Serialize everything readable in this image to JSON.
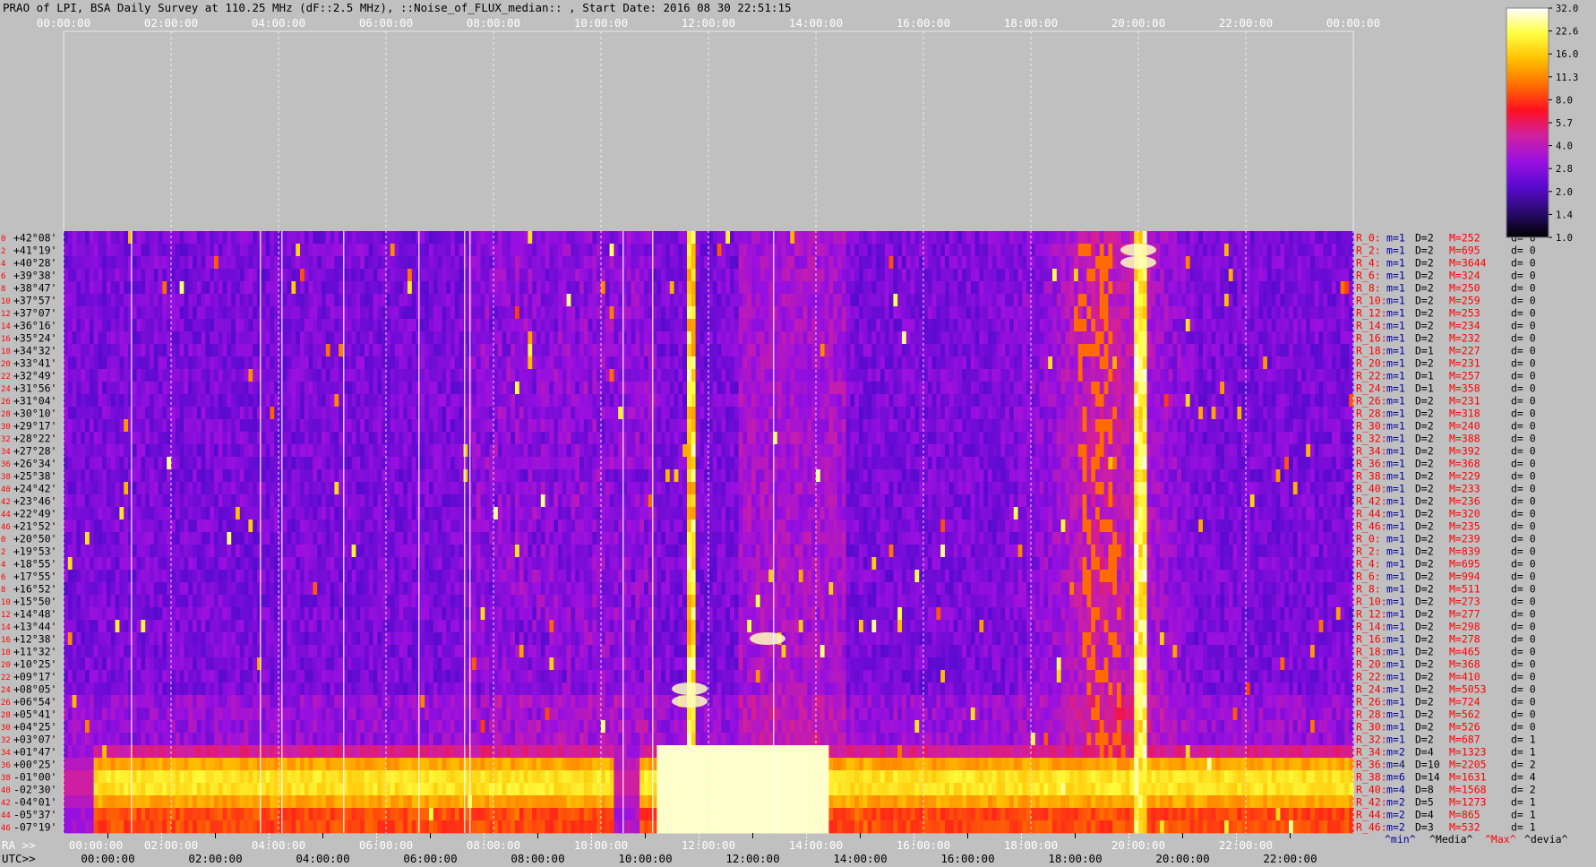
{
  "title": "PRAO of LPI, BSA Daily Survey at 110.25 MHz (dF::2.5 MHz), ::Noise_of_FLUX_median:: , Start Date: 2016 08 30 22:51:15",
  "chart_data": {
    "type": "heatmap",
    "top_axis_ticks": [
      "00:00:00",
      "02:00:00",
      "04:00:00",
      "06:00:00",
      "08:00:00",
      "10:00:00",
      "12:00:00",
      "14:00:00",
      "16:00:00",
      "18:00:00",
      "20:00:00",
      "22:00:00",
      "00:00:00"
    ],
    "ra_prefix": "RA >>",
    "ra_ticks": [
      "00:00:00",
      "02:00:00",
      "04:00:00",
      "06:00:00",
      "08:00:00",
      "10:00:00",
      "12:00:00",
      "14:00:00",
      "16:00:00",
      "18:00:00",
      "20:00:00",
      "22:00:00"
    ],
    "utc_prefix": "UTC>>",
    "utc_ticks": [
      "00:00:00",
      "02:00:00",
      "04:00:00",
      "06:00:00",
      "08:00:00",
      "10:00:00",
      "12:00:00",
      "14:00:00",
      "16:00:00",
      "18:00:00",
      "20:00:00",
      "22:00:00"
    ],
    "row_index_labels": [
      "0",
      "2",
      "4",
      "6",
      "8",
      "10",
      "12",
      "14",
      "16",
      "18",
      "20",
      "22",
      "24",
      "26",
      "28",
      "30",
      "32",
      "34",
      "36",
      "38",
      "40",
      "42",
      "44",
      "46",
      "0",
      "2",
      "4",
      "6",
      "8",
      "10",
      "12",
      "14",
      "16",
      "18",
      "20",
      "22",
      "24",
      "26",
      "28",
      "30",
      "32",
      "34",
      "36",
      "38",
      "40",
      "42",
      "44",
      "46"
    ],
    "declinations": [
      "+42°08'",
      "+41°19'",
      "+40°28'",
      "+39°38'",
      "+38°47'",
      "+37°57'",
      "+37°07'",
      "+36°16'",
      "+35°24'",
      "+34°32'",
      "+33°41'",
      "+32°49'",
      "+31°56'",
      "+31°04'",
      "+30°10'",
      "+29°17'",
      "+28°22'",
      "+27°28'",
      "+26°34'",
      "+25°38'",
      "+24°42'",
      "+23°46'",
      "+22°49'",
      "+21°52'",
      "+20°50'",
      "+19°53'",
      "+18°55'",
      "+17°55'",
      "+16°52'",
      "+15°50'",
      "+14°48'",
      "+13°44'",
      "+12°38'",
      "+11°32'",
      "+10°25'",
      "+09°17'",
      "+08°05'",
      "+06°54'",
      "+05°41'",
      "+04°25'",
      "+03°07'",
      "+01°47'",
      "+00°25'",
      "-01°00'",
      "-02°30'",
      "-04°01'",
      "-05°37'",
      "-07°19'"
    ],
    "row_stats": [
      {
        "label": "R_0:",
        "min": "m=1",
        "d": "D=2",
        "max": "M=252",
        "dev": "d= 0"
      },
      {
        "label": "R_2:",
        "min": "m=1",
        "d": "D=2",
        "max": "M=695",
        "dev": "d= 0"
      },
      {
        "label": "R_4:",
        "min": "m=1",
        "d": "D=2",
        "max": "M=3644",
        "dev": "d= 0"
      },
      {
        "label": "R_6:",
        "min": "m=1",
        "d": "D=2",
        "max": "M=324",
        "dev": "d= 0"
      },
      {
        "label": "R_8:",
        "min": "m=1",
        "d": "D=2",
        "max": "M=250",
        "dev": "d= 0"
      },
      {
        "label": "R_10:",
        "min": "m=1",
        "d": "D=2",
        "max": "M=259",
        "dev": "d= 0"
      },
      {
        "label": "R_12:",
        "min": "m=1",
        "d": "D=2",
        "max": "M=253",
        "dev": "d= 0"
      },
      {
        "label": "R_14:",
        "min": "m=1",
        "d": "D=2",
        "max": "M=234",
        "dev": "d= 0"
      },
      {
        "label": "R_16:",
        "min": "m=1",
        "d": "D=2",
        "max": "M=232",
        "dev": "d= 0"
      },
      {
        "label": "R_18:",
        "min": "m=1",
        "d": "D=1",
        "max": "M=227",
        "dev": "d= 0"
      },
      {
        "label": "R_20:",
        "min": "m=1",
        "d": "D=2",
        "max": "M=231",
        "dev": "d= 0"
      },
      {
        "label": "R_22:",
        "min": "m=1",
        "d": "D=1",
        "max": "M=257",
        "dev": "d= 0"
      },
      {
        "label": "R_24:",
        "min": "m=1",
        "d": "D=1",
        "max": "M=358",
        "dev": "d= 0"
      },
      {
        "label": "R_26:",
        "min": "m=1",
        "d": "D=2",
        "max": "M=231",
        "dev": "d= 0"
      },
      {
        "label": "R_28:",
        "min": "m=1",
        "d": "D=2",
        "max": "M=318",
        "dev": "d= 0"
      },
      {
        "label": "R_30:",
        "min": "m=1",
        "d": "D=2",
        "max": "M=240",
        "dev": "d= 0"
      },
      {
        "label": "R_32:",
        "min": "m=1",
        "d": "D=2",
        "max": "M=388",
        "dev": "d= 0"
      },
      {
        "label": "R_34:",
        "min": "m=1",
        "d": "D=2",
        "max": "M=392",
        "dev": "d= 0"
      },
      {
        "label": "R_36:",
        "min": "m=1",
        "d": "D=2",
        "max": "M=368",
        "dev": "d= 0"
      },
      {
        "label": "R_38:",
        "min": "m=1",
        "d": "D=2",
        "max": "M=229",
        "dev": "d= 0"
      },
      {
        "label": "R_40:",
        "min": "m=1",
        "d": "D=2",
        "max": "M=233",
        "dev": "d= 0"
      },
      {
        "label": "R_42:",
        "min": "m=1",
        "d": "D=2",
        "max": "M=236",
        "dev": "d= 0"
      },
      {
        "label": "R_44:",
        "min": "m=1",
        "d": "D=2",
        "max": "M=320",
        "dev": "d= 0"
      },
      {
        "label": "R_46:",
        "min": "m=1",
        "d": "D=2",
        "max": "M=235",
        "dev": "d= 0"
      },
      {
        "label": "R_0:",
        "min": "m=1",
        "d": "D=2",
        "max": "M=239",
        "dev": "d= 0"
      },
      {
        "label": "R_2:",
        "min": "m=1",
        "d": "D=2",
        "max": "M=839",
        "dev": "d= 0"
      },
      {
        "label": "R_4:",
        "min": "m=1",
        "d": "D=2",
        "max": "M=695",
        "dev": "d= 0"
      },
      {
        "label": "R_6:",
        "min": "m=1",
        "d": "D=2",
        "max": "M=994",
        "dev": "d= 0"
      },
      {
        "label": "R_8:",
        "min": "m=1",
        "d": "D=2",
        "max": "M=511",
        "dev": "d= 0"
      },
      {
        "label": "R_10:",
        "min": "m=1",
        "d": "D=2",
        "max": "M=273",
        "dev": "d= 0"
      },
      {
        "label": "R_12:",
        "min": "m=1",
        "d": "D=2",
        "max": "M=277",
        "dev": "d= 0"
      },
      {
        "label": "R_14:",
        "min": "m=1",
        "d": "D=2",
        "max": "M=298",
        "dev": "d= 0"
      },
      {
        "label": "R_16:",
        "min": "m=1",
        "d": "D=2",
        "max": "M=278",
        "dev": "d= 0"
      },
      {
        "label": "R_18:",
        "min": "m=1",
        "d": "D=2",
        "max": "M=465",
        "dev": "d= 0"
      },
      {
        "label": "R_20:",
        "min": "m=1",
        "d": "D=2",
        "max": "M=368",
        "dev": "d= 0"
      },
      {
        "label": "R_22:",
        "min": "m=1",
        "d": "D=2",
        "max": "M=410",
        "dev": "d= 0"
      },
      {
        "label": "R_24:",
        "min": "m=1",
        "d": "D=2",
        "max": "M=5053",
        "dev": "d= 0"
      },
      {
        "label": "R_26:",
        "min": "m=1",
        "d": "D=2",
        "max": "M=724",
        "dev": "d= 0"
      },
      {
        "label": "R_28:",
        "min": "m=1",
        "d": "D=2",
        "max": "M=562",
        "dev": "d= 0"
      },
      {
        "label": "R_30:",
        "min": "m=1",
        "d": "D=2",
        "max": "M=526",
        "dev": "d= 0"
      },
      {
        "label": "R_32:",
        "min": "m=1",
        "d": "D=2",
        "max": "M=687",
        "dev": "d= 1"
      },
      {
        "label": "R_34:",
        "min": "m=2",
        "d": "D=4",
        "max": "M=1323",
        "dev": "d= 1"
      },
      {
        "label": "R_36:",
        "min": "m=4",
        "d": "D=10",
        "max": "M=2205",
        "dev": "d= 2"
      },
      {
        "label": "R_38:",
        "min": "m=6",
        "d": "D=14",
        "max": "M=1631",
        "dev": "d= 4"
      },
      {
        "label": "R_40:",
        "min": "m=4",
        "d": "D=8",
        "max": "M=1568",
        "dev": "d= 2"
      },
      {
        "label": "R_42:",
        "min": "m=2",
        "d": "D=5",
        "max": "M=1273",
        "dev": "d= 1"
      },
      {
        "label": "R_44:",
        "min": "m=2",
        "d": "D=4",
        "max": "M=865",
        "dev": "d= 1"
      },
      {
        "label": "R_46:",
        "min": "m=2",
        "d": "D=3",
        "max": "M=532",
        "dev": "d= 1"
      }
    ],
    "stats_footer": [
      {
        "text": "^min^",
        "color": "#0000a0"
      },
      {
        "text": "^Media^",
        "color": "#000000"
      },
      {
        "text": "^Max^",
        "color": "#ff0000"
      },
      {
        "text": "^devia^",
        "color": "#000000"
      }
    ],
    "colorbar": {
      "ticks": [
        "32.0",
        "22.6",
        "16.0",
        "11.3",
        "8.0",
        "5.7",
        "4.0",
        "2.8",
        "2.0",
        "1.4",
        "1.0"
      ],
      "stops": [
        "#000000",
        "#2a0a6e",
        "#5a0ad0",
        "#9a10e0",
        "#d020a0",
        "#ff1020",
        "#ff7000",
        "#ffc000",
        "#ffff40",
        "#ffffff"
      ]
    },
    "colors": {
      "label_red": "#ff0000",
      "label_blue": "#0000a0",
      "tick_white": "#ffffff",
      "background": "#c0c0c0"
    }
  }
}
